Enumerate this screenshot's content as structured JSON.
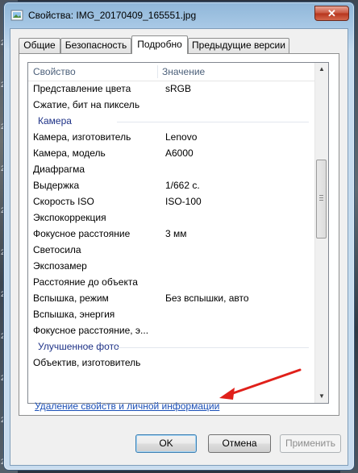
{
  "window": {
    "title": "Свойства: IMG_20170409_165551.jpg",
    "close_glyph": "✕"
  },
  "background": {
    "left_digits": [
      "2",
      "2",
      "2",
      "2",
      "20",
      "2",
      "20",
      "20",
      "2",
      "20",
      "20"
    ],
    "right_digits": []
  },
  "tabs": [
    {
      "label": "Общие"
    },
    {
      "label": "Безопасность"
    },
    {
      "label": "Подробно"
    },
    {
      "label": "Предыдущие версии"
    }
  ],
  "table": {
    "header": {
      "col1": "Свойство",
      "col2": "Значение"
    },
    "rows": [
      {
        "k": "Представление цвета",
        "v": "sRGB"
      },
      {
        "k": "Сжатие, бит на пиксель",
        "v": ""
      },
      {
        "group": "Камера"
      },
      {
        "k": "Камера, изготовитель",
        "v": "Lenovo"
      },
      {
        "k": "Камера, модель",
        "v": "A6000"
      },
      {
        "k": "Диафрагма",
        "v": ""
      },
      {
        "k": "Выдержка",
        "v": "1/662 с."
      },
      {
        "k": "Скорость ISO",
        "v": "ISO-100"
      },
      {
        "k": "Экспокоррекция",
        "v": ""
      },
      {
        "k": "Фокусное расстояние",
        "v": "3 мм"
      },
      {
        "k": "Светосила",
        "v": ""
      },
      {
        "k": "Экспозамер",
        "v": ""
      },
      {
        "k": "Расстояние до объекта",
        "v": ""
      },
      {
        "k": "Вспышка, режим",
        "v": "Без вспышки, авто"
      },
      {
        "k": "Вспышка, энергия",
        "v": ""
      },
      {
        "k": "Фокусное расстояние, э...",
        "v": ""
      },
      {
        "group": "Улучшенное фото"
      },
      {
        "k": "Объектив, изготовитель",
        "v": ""
      }
    ]
  },
  "remove_link": "Удаление свойств и личной информации",
  "buttons": {
    "ok": "OK",
    "cancel": "Отмена",
    "apply": "Применить"
  },
  "colors": {
    "link": "#1a4fb7",
    "group_header": "#1e3287",
    "annotation_arrow": "#e0201a"
  }
}
